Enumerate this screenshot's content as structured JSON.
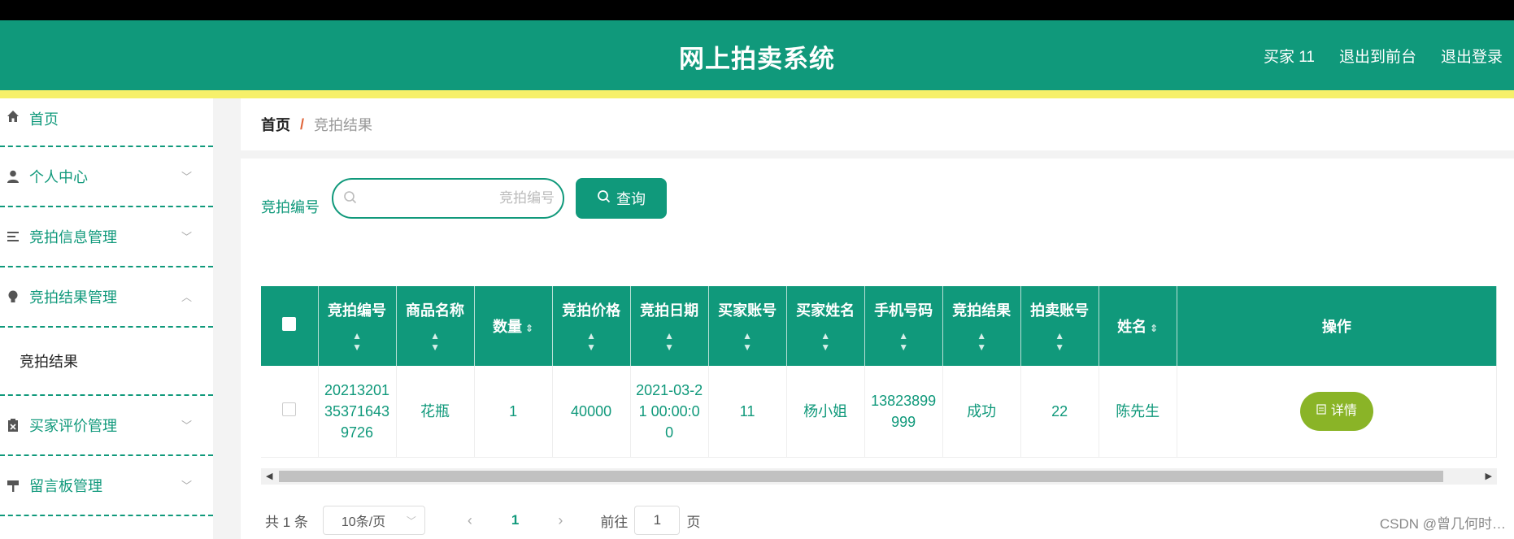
{
  "header": {
    "title": "网上拍卖系统",
    "user": "买家 11",
    "back_to_front": "退出到前台",
    "logout": "退出登录"
  },
  "sidebar": {
    "items": [
      {
        "label": "首页",
        "icon": "home-icon"
      },
      {
        "label": "个人中心",
        "icon": "user-icon"
      },
      {
        "label": "竞拍信息管理",
        "icon": "list-icon"
      },
      {
        "label": "竞拍结果管理",
        "icon": "bulb-icon",
        "expanded": true,
        "children": [
          "竞拍结果"
        ]
      },
      {
        "label": "买家评价管理",
        "icon": "clipboard-icon"
      },
      {
        "label": "留言板管理",
        "icon": "sign-icon"
      }
    ]
  },
  "breadcrumb": {
    "home": "首页",
    "separator": "/",
    "current": "竞拍结果"
  },
  "search": {
    "label": "竞拍编号",
    "placeholder": "竞拍编号",
    "value": "",
    "button": "查询"
  },
  "table": {
    "columns": [
      "竞拍编号",
      "商品名称",
      "数量",
      "竞拍价格",
      "竞拍日期",
      "买家账号",
      "买家姓名",
      "手机号码",
      "竞拍结果",
      "拍卖账号",
      "姓名",
      "操作"
    ],
    "rows": [
      [
        "20213201353716439726",
        "花瓶",
        "1",
        "40000",
        "2021-03-21 00:00:00",
        "11",
        "杨小姐",
        "13823899999",
        "成功",
        "22",
        "陈先生"
      ]
    ],
    "action_label": "详情"
  },
  "pagination": {
    "total": "共 1 条",
    "page_size": "10条/页",
    "current_page": "1",
    "goto_prefix": "前往",
    "goto_value": "1",
    "goto_suffix": "页"
  },
  "watermark": "CSDN @曾几何时…",
  "colors": {
    "primary": "#10997b",
    "stripe": "#f6f06a",
    "detail_button": "#8ab427"
  }
}
